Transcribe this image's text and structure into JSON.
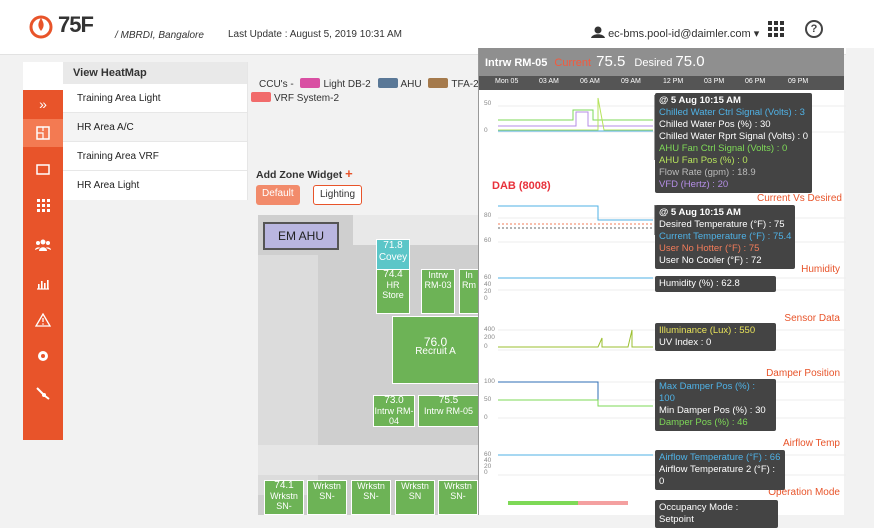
{
  "header": {
    "brand": "75F",
    "location": "/ MBRDI, Bangalore",
    "last_update": "Last Update : August 5, 2019 10:31 AM",
    "user": "ec-bms.pool-id@daimler.com ▾",
    "help": "?"
  },
  "menu": {
    "title": "View HeatMap",
    "items": [
      {
        "label": "Training Area Light"
      },
      {
        "label": "HR Area A/C"
      },
      {
        "label": "Training Area VRF"
      },
      {
        "label": "HR Area Light"
      }
    ]
  },
  "ccu": {
    "prefix": "CCU's -",
    "items": [
      {
        "label": "Light DB-2",
        "color": "#d94fa3"
      },
      {
        "label": "AHU",
        "color": "#5a7897"
      },
      {
        "label": "TFA-2",
        "color": "#a57a4c"
      },
      {
        "label": "VRF System-2",
        "color": "#f16b6b"
      }
    ]
  },
  "widget": {
    "add_label": "Add Zone Widget",
    "default_btn": "Default",
    "lighting_btn": "Lighting"
  },
  "floor": {
    "emahu": "EM AHU",
    "covey_val": "71.8",
    "covey_name": "Covey",
    "zones": [
      {
        "val": "74.4",
        "name": "HR Store"
      },
      {
        "val": "",
        "name": "Intrw RM-03"
      },
      {
        "val": "",
        "name": "In Rm"
      },
      {
        "val": "76.0",
        "name": "Recruit A"
      },
      {
        "val": "73.0",
        "name": "Intrw RM-04"
      },
      {
        "val": "75.5",
        "name": "Intrw RM-05"
      },
      {
        "val": "74.1",
        "name": "Wrkstn SN-"
      },
      {
        "val": "",
        "name": "Wrkstn SN-"
      },
      {
        "val": "",
        "name": "Wrkstn SN-"
      },
      {
        "val": "",
        "name": "Wrkstn SN"
      },
      {
        "val": "",
        "name": "Wrkstn SN-"
      }
    ]
  },
  "overlay": {
    "name": "Intrw RM-05",
    "current_label": "Current",
    "current": "75.5",
    "desired_label": "Desired",
    "desired": "75.0",
    "times": [
      "Mon 05",
      "03 AM",
      "06 AM",
      "09 AM",
      "12 PM",
      "03 PM",
      "06 PM",
      "09 PM"
    ],
    "dab": "DAB (8008)",
    "sections": {
      "current_vs_desired": "Current Vs Desired",
      "humidity": "Humidity",
      "sensor": "Sensor Data",
      "damper": "Damper Position",
      "airflow": "Airflow Temp",
      "operation": "Operation Mode"
    },
    "tip1": {
      "head": "@ 5 Aug 10:15 AM",
      "lines": [
        {
          "t": "Chilled Water Ctrl Signal (Volts) : 3",
          "c": "#4fb2e6"
        },
        {
          "t": "Chilled Water Pos (%) : 30",
          "c": "#ffffff"
        },
        {
          "t": "Chilled Water Rprt Signal (Volts) : 0",
          "c": "#ffffff"
        },
        {
          "t": "AHU Fan Ctrl Signal (Volts) : 0",
          "c": "#7ed957"
        },
        {
          "t": "AHU Fan Pos (%) : 0",
          "c": "#b6e35c"
        },
        {
          "t": "Flow Rate (gpm) : 18.9",
          "c": "#bbbbbb"
        },
        {
          "t": "VFD (Hertz) : 20",
          "c": "#b48ee6"
        }
      ]
    },
    "tip2": {
      "head": "@ 5 Aug 10:15 AM",
      "lines": [
        {
          "t": "Desired Temperature (°F) : 75",
          "c": "#ffffff"
        },
        {
          "t": "Current Temperature (°F) : 75.4",
          "c": "#4fb2e6"
        },
        {
          "t": "User No Hotter (°F) : 75",
          "c": "#f27c5a"
        },
        {
          "t": "User No Cooler (°F) : 72",
          "c": "#ffffff"
        }
      ]
    },
    "tip3": {
      "lines": [
        {
          "t": "Humidity (%) : 62.8",
          "c": "#ffffff"
        }
      ]
    },
    "tip4": {
      "lines": [
        {
          "t": "Illuminance (Lux) : 550",
          "c": "#e8e35a"
        },
        {
          "t": "UV Index : 0",
          "c": "#ffffff"
        }
      ]
    },
    "tip5": {
      "lines": [
        {
          "t": "Max Damper Pos (%) : 100",
          "c": "#4fb2e6"
        },
        {
          "t": "Min Damper Pos (%) : 30",
          "c": "#ffffff"
        },
        {
          "t": "Damper Pos (%) : 46",
          "c": "#7ed957"
        }
      ]
    },
    "tip6": {
      "lines": [
        {
          "t": "Airflow Temperature (°F) : 66",
          "c": "#4fb2e6"
        },
        {
          "t": "Airflow Temperature 2 (°F) : 0",
          "c": "#ffffff"
        }
      ]
    },
    "tip7": {
      "lines": [
        {
          "t": "Occupancy Mode : Setpoint",
          "c": "#ffffff"
        }
      ]
    },
    "axes": {
      "a1": [
        "50",
        "0"
      ],
      "a2": [
        "80",
        "60"
      ],
      "a3": [
        "60",
        "40",
        "20",
        "0"
      ],
      "a4": [
        "400",
        "200",
        "0"
      ],
      "a5": [
        "100",
        "50",
        "0"
      ],
      "a6": [
        "60",
        "40",
        "20",
        "0"
      ]
    }
  }
}
